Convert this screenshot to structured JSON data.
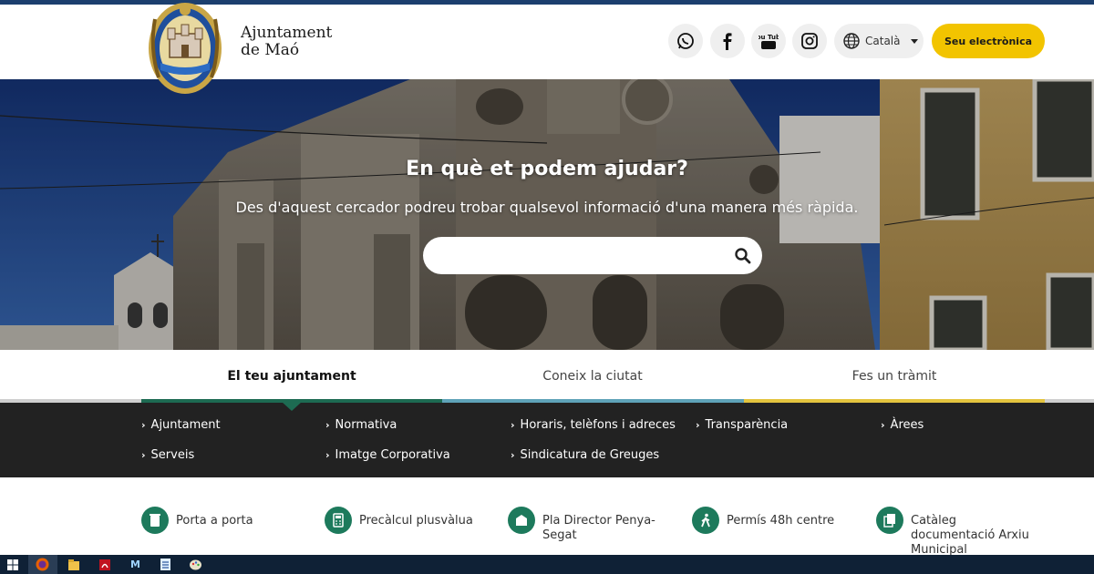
{
  "header": {
    "logo_line1": "Ajuntament",
    "logo_line2": "de Maó",
    "social": [
      "whatsapp-icon",
      "facebook-icon",
      "youtube-icon",
      "instagram-icon"
    ],
    "youtube_text": "You Tube",
    "language": "Català",
    "cta_label": "Seu electrònica"
  },
  "hero": {
    "title": "En què et podem ajudar?",
    "subtitle": "Des d'aquest cercador podreu trobar qualsevol informació d'una manera més ràpida.",
    "search_value": "",
    "search_placeholder": ""
  },
  "tabs": [
    {
      "label": "El teu ajuntament",
      "active": true,
      "color": "#1d6b52"
    },
    {
      "label": "Coneix la ciutat",
      "active": false,
      "color": "#5fa3b8"
    },
    {
      "label": "Fes un tràmit",
      "active": false,
      "color": "#e3c43f"
    }
  ],
  "links": [
    "Ajuntament",
    "Normativa",
    "Horaris, telèfons i adreces",
    "Transparència",
    "Àrees",
    "Serveis",
    "Imatge Corporativa",
    "Sindicatura de Greuges"
  ],
  "tiles": [
    {
      "label": "Porta a porta",
      "icon": "recycle-bin-icon"
    },
    {
      "label": "Precàlcul plusvàlua",
      "icon": "calculator-icon"
    },
    {
      "label": "Pla Director Penya-Segat",
      "icon": "document-plan-icon"
    },
    {
      "label": "Permís 48h centre",
      "icon": "walking-person-icon"
    },
    {
      "label": "Catàleg documentació Arxiu Municipal",
      "icon": "archive-catalog-icon"
    }
  ],
  "colors": {
    "accent_yellow": "#f2c400",
    "dark_panel": "#222222",
    "tile_green": "#1d7a5c",
    "taskbar": "#0f2136"
  }
}
